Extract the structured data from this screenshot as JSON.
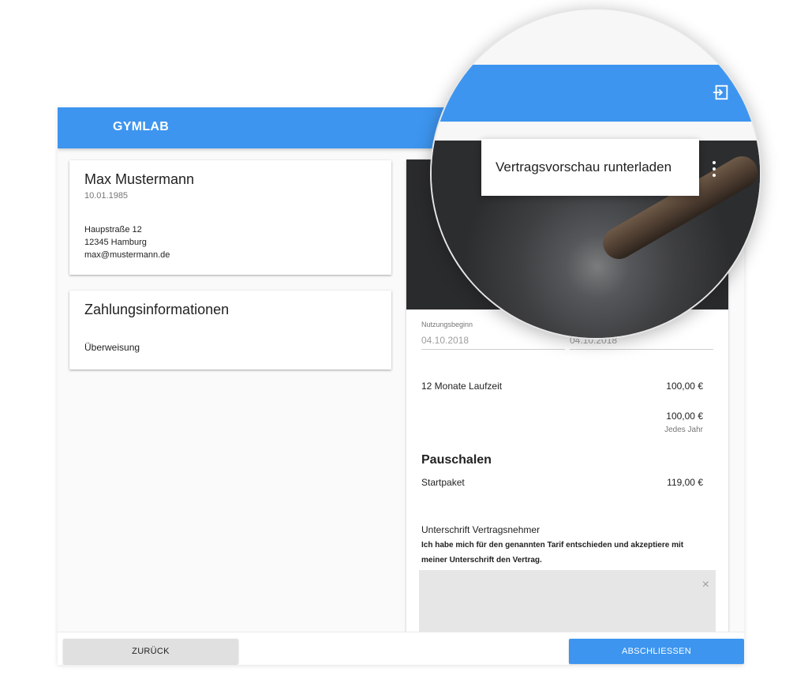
{
  "app": {
    "brand": "GYMLAB"
  },
  "profile": {
    "name": "Max Mustermann",
    "dob": "10.01.1985",
    "street": "Haupstraße 12",
    "city": "12345 Hamburg",
    "email": "max@mustermann.de"
  },
  "payment": {
    "title": "Zahlungsinformationen",
    "method": "Überweisung"
  },
  "contract": {
    "start_label": "Nutzungsbeginn",
    "start_value": "04.10.2018",
    "second_value": "04.10.2018",
    "term_label": "12 Monate Laufzeit",
    "term_price": "100,00 €",
    "recurring_price": "100,00 €",
    "recurring_period": "Jedes Jahr",
    "fees_title": "Pauschalen",
    "fee_label": "Startpaket",
    "fee_price": "119,00 €"
  },
  "signature": {
    "title": "Unterschrift Vertragsnehmer",
    "text": "Ich habe mich für den genannten Tarif entschieden und akzeptiere mit meiner Unterschrift den Vertrag.",
    "close_icon": "×"
  },
  "footer": {
    "back_label": "ZURÜCK",
    "finish_label": "ABSCHLIESSEN"
  },
  "magnifier": {
    "menu_label": "Vertragsvorschau runterladen"
  },
  "colors": {
    "primary": "#3d95ef"
  }
}
